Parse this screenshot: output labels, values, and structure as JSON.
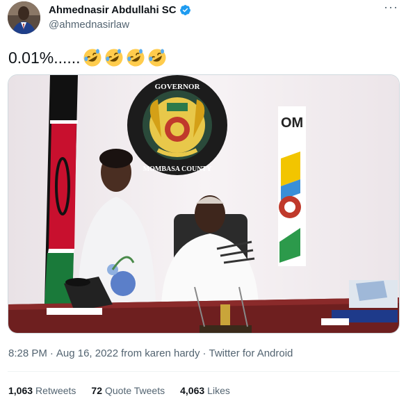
{
  "author": {
    "display_name": "Ahmednasir Abdullahi SC",
    "handle": "@ahmednasirlaw",
    "verified": true
  },
  "more_icon": "more-dots-icon",
  "tweet": {
    "text": "0.01%......",
    "emojis": [
      "rolling-on-floor-laughing",
      "rolling-on-floor-laughing",
      "rolling-on-floor-laughing",
      "rolling-on-floor-laughing"
    ]
  },
  "media": {
    "seal_text_top": "GOVERNOR",
    "seal_text_bottom": "MOMBASA COUNTY",
    "banner_text": "OM"
  },
  "meta": {
    "time": "8:28 PM",
    "sep1": "·",
    "date": "Aug 16, 2022",
    "from": "from karen hardy",
    "sep2": "·",
    "client": "Twitter for Android"
  },
  "stats": {
    "retweets_count": "1,063",
    "retweets_label": "Retweets",
    "quotes_count": "72",
    "quotes_label": "Quote Tweets",
    "likes_count": "4,063",
    "likes_label": "Likes"
  },
  "colors": {
    "verified_blue": "#1d9bf0",
    "secondary_text": "#536471"
  }
}
